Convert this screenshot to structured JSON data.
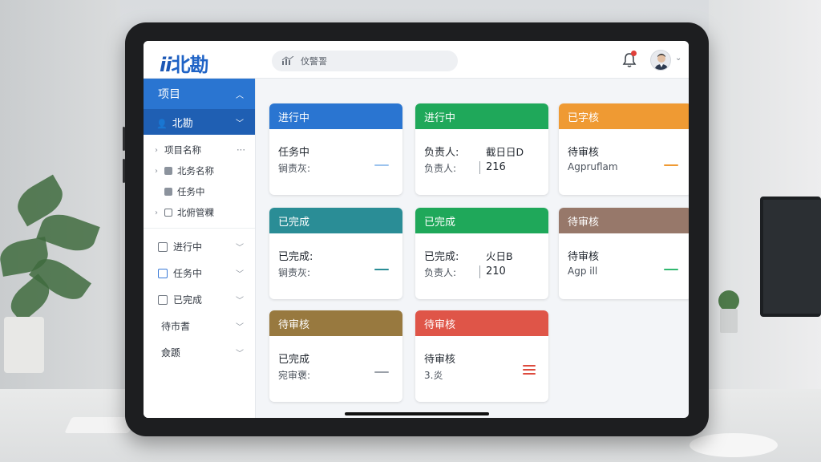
{
  "app": {
    "logo_mark": "ii",
    "logo_text": "北勘"
  },
  "search": {
    "text": "伩警䛐"
  },
  "sidebar": {
    "header": "项目",
    "sub_header": "北勘",
    "tree": [
      {
        "label": "项目名称",
        "chevron": "›",
        "kind": "none",
        "more": "···"
      },
      {
        "label": "北务名称",
        "chevron": "›",
        "kind": "filled",
        "more": ""
      },
      {
        "label": "任务中",
        "chevron": "",
        "kind": "filled",
        "more": ""
      },
      {
        "label": "北俯管粿",
        "chevron": "›",
        "kind": "outline",
        "more": ""
      }
    ],
    "items": [
      {
        "label": "进行中",
        "box": "plain"
      },
      {
        "label": "任务中",
        "box": "blue"
      },
      {
        "label": "已完成",
        "box": "plain"
      }
    ],
    "extra_items": [
      {
        "label": "待市耆"
      },
      {
        "label": "僉踬"
      }
    ]
  },
  "cards": [
    {
      "header": "进行中",
      "color": "#2a75d1",
      "line1": "任务中",
      "line2": "锏责灰:",
      "val1": "",
      "val2": "",
      "marker": "dash",
      "marker_color": "#9cc3ee"
    },
    {
      "header": "进行中",
      "color": "#1fa85a",
      "line1": "负责人:",
      "line2": "负责人:",
      "val1": "截日日D",
      "val2": "216",
      "marker": "none",
      "marker_color": ""
    },
    {
      "header": "已字核",
      "color": "#ef9a33",
      "line1": "待审核",
      "line2": "Agpruflam",
      "val1": "",
      "val2": "",
      "marker": "dash",
      "marker_color": "#ef9a33"
    },
    {
      "header": "已完成",
      "color": "#2a8d96",
      "line1": "已完成:",
      "line2": "锏责灰:",
      "val1": "",
      "val2": "",
      "marker": "dash",
      "marker_color": "#2a8d96"
    },
    {
      "header": "已完成",
      "color": "#1fa85a",
      "line1": "已完成:",
      "line2": "负责人:",
      "val1": "火日B",
      "val2": "210",
      "marker": "none",
      "marker_color": ""
    },
    {
      "header": "待审核",
      "color": "#97786a",
      "line1": "待审核",
      "line2": "Agp ill",
      "val1": "",
      "val2": "",
      "marker": "dash",
      "marker_color": "#31b870"
    },
    {
      "header": "待审核",
      "color": "#98793f",
      "line1": "已完成",
      "line2": "宛审褒:",
      "val1": "",
      "val2": "",
      "marker": "dash",
      "marker_color": "#9aa0a8"
    },
    {
      "header": "待审核",
      "color": "#df5548",
      "line1": "待审核",
      "line2": "3.炎",
      "val1": "",
      "val2": "",
      "marker": "list",
      "marker_color": "#dd4b3e"
    }
  ]
}
